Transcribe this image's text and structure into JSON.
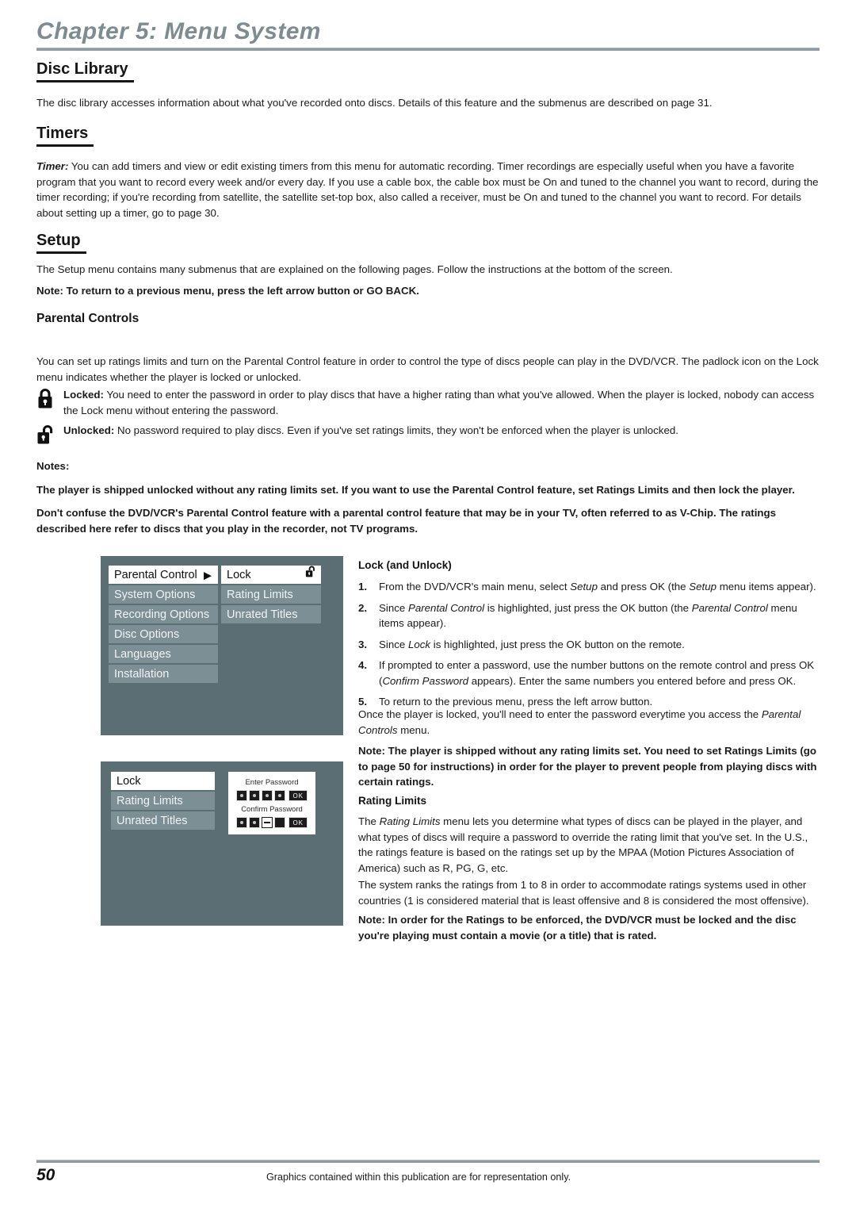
{
  "header": {
    "chapter_title": "Chapter 5: Menu System"
  },
  "sections": {
    "disc_library": {
      "heading": "Disc Library",
      "paragraph": "The disc library accesses information about what you've recorded onto discs. Details of this feature and the submenus are described on page 31."
    },
    "timers": {
      "heading": "Timers",
      "lead_italic": "Timer:",
      "paragraph": " You can add timers and view or edit existing timers from this menu for automatic recording. Timer recordings are especially useful when you have a favorite program that you want to record every week and/or every day. If you use a cable box, the cable box must be On and tuned to the channel you want to record, during the timer recording; if you're recording from satellite, the satellite set-top box, also called a receiver, must be On and tuned to the channel you want to record. For details about setting up a timer, go to page 30."
    },
    "setup": {
      "heading": "Setup",
      "paragraph": "The Setup menu contains many submenus that are explained on the following pages. Follow the instructions at the bottom of the screen.",
      "note": "Note: To return to a previous menu, press the left arrow button or GO BACK."
    },
    "parental_controls": {
      "heading": "Parental Controls",
      "paragraph": "You can set up ratings limits and turn on the Parental Control feature in order to control the type of discs people can play in the DVD/VCR. The padlock icon on the Lock menu indicates whether the player is locked or unlocked.",
      "locked_label": "Locked:",
      "locked_text": " You need to enter the password in order to play discs that have a higher rating than what you've allowed. When the player is locked, nobody can access the Lock menu without entering the password.",
      "unlocked_label": "Unlocked:",
      "unlocked_text": " No password required to play discs. Even if you've set ratings limits, they won't be enforced when the player is unlocked.",
      "notes_label": "Notes:",
      "note_1": "The player is shipped unlocked without any rating limits set. If you want to use the Parental Control feature, set Ratings Limits and then lock the player.",
      "note_2": "Don't confuse the DVD/VCR's Parental Control feature with a parental control feature that may be in your TV, often referred to as V-Chip. The ratings described here refer to discs that you play in the recorder, not TV programs."
    }
  },
  "menu_graphic_1": {
    "left_items": [
      "Parental Control",
      "System Options",
      "Recording Options",
      "Disc Options",
      "Languages",
      "Installation"
    ],
    "left_selected_index": 0,
    "right_items": [
      "Lock",
      "Rating Limits",
      "Unrated Titles"
    ],
    "right_selected_index": 0,
    "arrow_glyph": "▶",
    "padlock_state": "unlocked",
    "bg_color": "#5b6e73",
    "item_color": "#7b8f94",
    "selected_color": "#ffffff"
  },
  "menu_graphic_2": {
    "left_items": [
      "Lock",
      "Rating Limits",
      "Unrated Titles"
    ],
    "left_selected_index": 0,
    "dialog": {
      "enter_label": "Enter Password",
      "confirm_label": "Confirm Password",
      "ok_label": "OK",
      "enter_cells": [
        "dot",
        "dot",
        "dot",
        "dot"
      ],
      "confirm_cells": [
        "dot",
        "dot",
        "cursor",
        "empty"
      ]
    },
    "bg_color": "#5b6e73"
  },
  "right_column": {
    "lock_heading": "Lock (and Unlock)",
    "steps": [
      {
        "num": "1.",
        "html_key": "step1"
      },
      {
        "num": "2.",
        "html_key": "step2"
      },
      {
        "num": "3.",
        "html_key": "step3"
      },
      {
        "num": "4.",
        "html_key": "step4"
      },
      {
        "num": "5.",
        "html_key": "step5"
      }
    ],
    "step1_a": "From the DVD/VCR's main menu, select ",
    "step1_i1": "Setup",
    "step1_b": " and press OK (the ",
    "step1_i2": "Setup",
    "step1_c": " menu items appear).",
    "step2_a": "Since ",
    "step2_i1": "Parental Control",
    "step2_b": " is highlighted, just press the OK button (the ",
    "step2_i2": "Parental Control",
    "step2_c": " menu items appear).",
    "step3_a": "Since ",
    "step3_i1": "Lock",
    "step3_b": " is highlighted, just press the OK button on the remote.",
    "step4_a": "If prompted to enter a password, use the number buttons on the remote control and press OK (",
    "step4_i1": "Confirm Password",
    "step4_b": " appears). Enter the same numbers you entered before and press OK.",
    "step5_a": "To return to the previous menu, press the left arrow button.",
    "para_locked_a": "Once the player is locked, you'll need to enter the password everytime you access the ",
    "para_locked_i": "Parental Controls",
    "para_locked_b": " menu.",
    "note_ratings": "Note: The player is shipped without any rating limits set. You need to set Ratings Limits (go to page 50 for instructions) in order for the player to prevent people from playing discs with certain ratings.",
    "rating_limits_heading": "Rating Limits",
    "rating_limits_a": "The ",
    "rating_limits_i": "Rating Limits",
    "rating_limits_b": " menu lets you determine what types of discs can be played in the player, and what types of discs will require a password to override the rating limit that you've set. In the U.S., the ratings feature is based on the ratings set up by the MPAA (Motion Pictures Association of America) such as R, PG, G, etc.",
    "ranks_paragraph": "The system ranks the ratings from 1 to 8 in order to accommodate ratings systems used in other countries (1 is considered material that is least offensive and 8 is considered the most offensive).",
    "note_enforced": "Note: In order for the Ratings to be enforced, the DVD/VCR must be locked and the disc you're playing must contain a movie (or a title) that is rated."
  },
  "footer": {
    "page_number": "50",
    "note": "Graphics contained within this publication are for representation only."
  }
}
